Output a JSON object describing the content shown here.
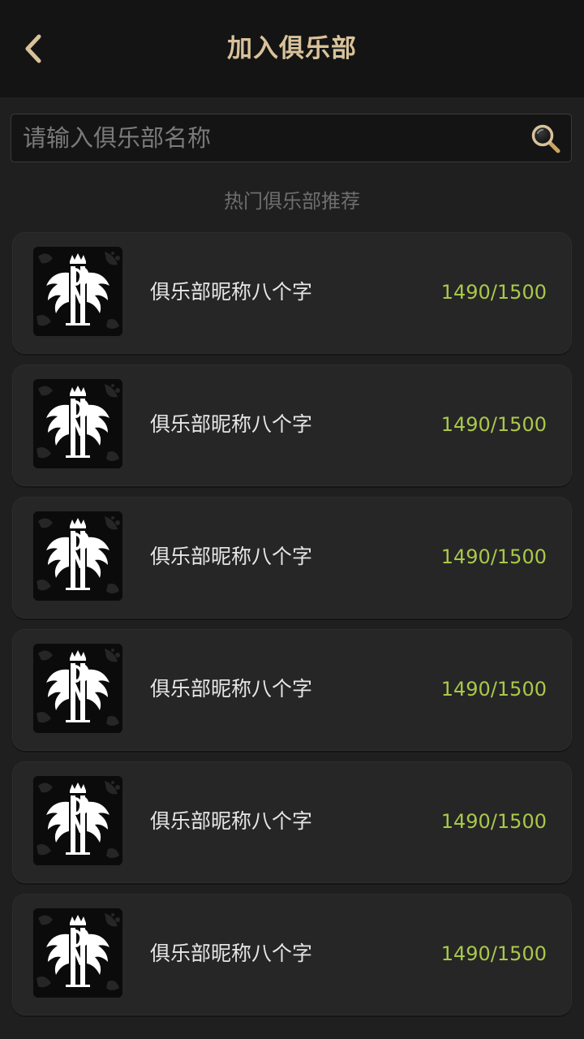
{
  "header": {
    "title": "加入俱乐部"
  },
  "search": {
    "placeholder": "请输入俱乐部名称",
    "value": ""
  },
  "section": {
    "title": "热门俱乐部推荐"
  },
  "clubs": [
    {
      "name": "俱乐部昵称八个字",
      "members": "1490/1500"
    },
    {
      "name": "俱乐部昵称八个字",
      "members": "1490/1500"
    },
    {
      "name": "俱乐部昵称八个字",
      "members": "1490/1500"
    },
    {
      "name": "俱乐部昵称八个字",
      "members": "1490/1500"
    },
    {
      "name": "俱乐部昵称八个字",
      "members": "1490/1500"
    },
    {
      "name": "俱乐部昵称八个字",
      "members": "1490/1500"
    }
  ],
  "colors": {
    "title": "#d8c29a",
    "member_count": "#a9c84a",
    "background": "#1f1f20"
  },
  "icons": {
    "back": "chevron-left-icon",
    "search": "magnifier-icon",
    "club_logo": "crest-logo-icon"
  }
}
